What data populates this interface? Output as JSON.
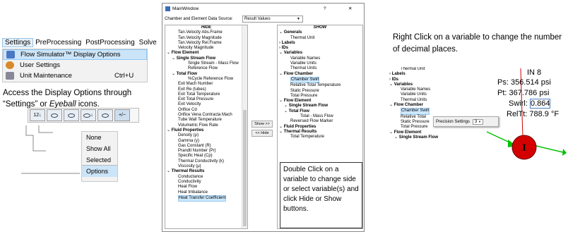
{
  "menubar": [
    "Settings",
    "PreProcessing",
    "PostProcessing",
    "Solve"
  ],
  "settings_menu": [
    {
      "label": "Flow Simulator™ Display Options",
      "shortcut": "",
      "icon": "display-options-icon"
    },
    {
      "label": "User Settings",
      "shortcut": "",
      "icon": "user-icon"
    },
    {
      "label": "Unit Maintenance",
      "shortcut": "Ctrl+U",
      "icon": "wrench-icon"
    }
  ],
  "caption_left": [
    "Access the Display Options through",
    "“Settings” or ",
    "Eyeball",
    " icons."
  ],
  "toolbar": {
    "labels": [
      "12↓",
      "",
      "",
      "↓",
      "+/−"
    ]
  },
  "eye_menu": [
    "None",
    "Show All",
    "Selected",
    "Options"
  ],
  "window": {
    "title": "MainWindow",
    "help": "?",
    "close": "✕",
    "source_label": "Chamber and Element Data Source:",
    "source_value": "Result Values",
    "hide_header": "HIDE",
    "show_header": "SHOW",
    "show_btn": "Show >>",
    "hide_btn": "<< Hide",
    "hide_items": [
      {
        "t": "Tan.Velocity Abs.Frame",
        "l": 2
      },
      {
        "t": "Tan.Velocity Magnitude",
        "l": 2
      },
      {
        "t": "Tan.Velocity Rel.Frame",
        "l": 2
      },
      {
        "t": "Velocity Magnitude",
        "l": 2
      },
      {
        "t": "Flow Element",
        "l": 0,
        "b": true
      },
      {
        "t": "Single Stream Flow",
        "l": 1,
        "b": true
      },
      {
        "t": "Single Stream - Mass Flow",
        "l": 3
      },
      {
        "t": "Reference Flow",
        "l": 3
      },
      {
        "t": "Total Flow",
        "l": 1,
        "b": true
      },
      {
        "t": "%Cycle Reference Flow",
        "l": 3
      },
      {
        "t": "Exit Mach Number",
        "l": 2
      },
      {
        "t": "Exit Re (tubes)",
        "l": 2
      },
      {
        "t": "Exit Total Temperature",
        "l": 2
      },
      {
        "t": "Exit Total Pressure",
        "l": 2
      },
      {
        "t": "Exit Velocity",
        "l": 2
      },
      {
        "t": "Orifice Cd",
        "l": 2
      },
      {
        "t": "Orifice Vena Contracta Mach",
        "l": 2
      },
      {
        "t": "Tube Wall Temperature",
        "l": 2
      },
      {
        "t": "Volumetric Flow Rate",
        "l": 2
      },
      {
        "t": "Fluid Properties",
        "l": 0,
        "b": true
      },
      {
        "t": "Density (ρ)",
        "l": 2
      },
      {
        "t": "Gamma (γ)",
        "l": 2
      },
      {
        "t": "Gas Constant (R)",
        "l": 2
      },
      {
        "t": "Prandtl Number (Pr)",
        "l": 2
      },
      {
        "t": "Specific Heat (Cp)",
        "l": 2
      },
      {
        "t": "Thermal Conductivity (k)",
        "l": 2
      },
      {
        "t": "Viscosity (μ)",
        "l": 2
      },
      {
        "t": "Thermal Results",
        "l": 0,
        "b": true
      },
      {
        "t": "Conductance",
        "l": 2
      },
      {
        "t": "Conductivity",
        "l": 2
      },
      {
        "t": "Heat Flow",
        "l": 2
      },
      {
        "t": "Heat Imbalance",
        "l": 2
      },
      {
        "t": "Heat Transfer Coefficient",
        "l": 2,
        "sel": true
      }
    ],
    "show_items": [
      {
        "t": "Generals",
        "l": 0,
        "b": true
      },
      {
        "t": "Thermal Unit",
        "l": 2
      },
      {
        "t": "Labels",
        "l": 0,
        "b": true,
        "c": true
      },
      {
        "t": "IDs",
        "l": 0,
        "b": true,
        "c": true
      },
      {
        "t": "Variables",
        "l": 0,
        "b": true
      },
      {
        "t": "Variable Names",
        "l": 2
      },
      {
        "t": "Variable Units",
        "l": 2
      },
      {
        "t": "Thermal Units",
        "l": 2
      },
      {
        "t": "Flow Chamber",
        "l": 0,
        "b": true
      },
      {
        "t": "Chamber Swirl",
        "l": 2,
        "sel": true
      },
      {
        "t": "Relative Total Temperature",
        "l": 2
      },
      {
        "t": "Static Pressure",
        "l": 2
      },
      {
        "t": "Total Pressure",
        "l": 2
      },
      {
        "t": "Flow Element",
        "l": 0,
        "b": true
      },
      {
        "t": "Single Stream Flow",
        "l": 1,
        "b": true
      },
      {
        "t": "Total Flow",
        "l": 1,
        "b": true
      },
      {
        "t": "Total - Mass Flow",
        "l": 3
      },
      {
        "t": "Reversed Flow Marker",
        "l": 2
      },
      {
        "t": "Fluid Properties",
        "l": 0,
        "b": true
      },
      {
        "t": "Thermal Results",
        "l": 0,
        "b": true
      },
      {
        "t": "Total Temperature",
        "l": 2
      }
    ],
    "note": "Double Click on a variable to change side or select variable(s) and click Hide or Show buttons."
  },
  "caption_right": "Right Click on a variable to change the number of decimal places.",
  "tree_right": [
    {
      "t": "Thermal Unit",
      "l": 2
    },
    {
      "t": "Labels",
      "l": 0,
      "b": true,
      "c": true
    },
    {
      "t": "IDs",
      "l": 0,
      "b": true,
      "c": true
    },
    {
      "t": "Variables",
      "l": 0,
      "b": true
    },
    {
      "t": "Variable Names",
      "l": 2
    },
    {
      "t": "Variable Units",
      "l": 2
    },
    {
      "t": "Thermal Units",
      "l": 2
    },
    {
      "t": "Flow Chamber",
      "l": 0,
      "b": true
    },
    {
      "t": "Chamber Swirl",
      "l": 2,
      "sel": true
    },
    {
      "t": "Relative Total",
      "l": 2
    },
    {
      "t": "Static Pressure",
      "l": 2
    },
    {
      "t": "Total Pressure",
      "l": 2
    },
    {
      "t": "Flow Element",
      "l": 0,
      "b": true
    },
    {
      "t": "Single Stream Flow",
      "l": 1,
      "b": true
    }
  ],
  "precision": {
    "label": "Precision Settings",
    "value": "3"
  },
  "chamber": {
    "name": "IN 8",
    "ps": "Ps: 356.514 psi",
    "pt": "Pt: 367.786 psi",
    "swirl_label": "Swirl: ",
    "swirl_value": "0.864",
    "relt": "RelTt: 788.9 °F",
    "marker": "I"
  }
}
